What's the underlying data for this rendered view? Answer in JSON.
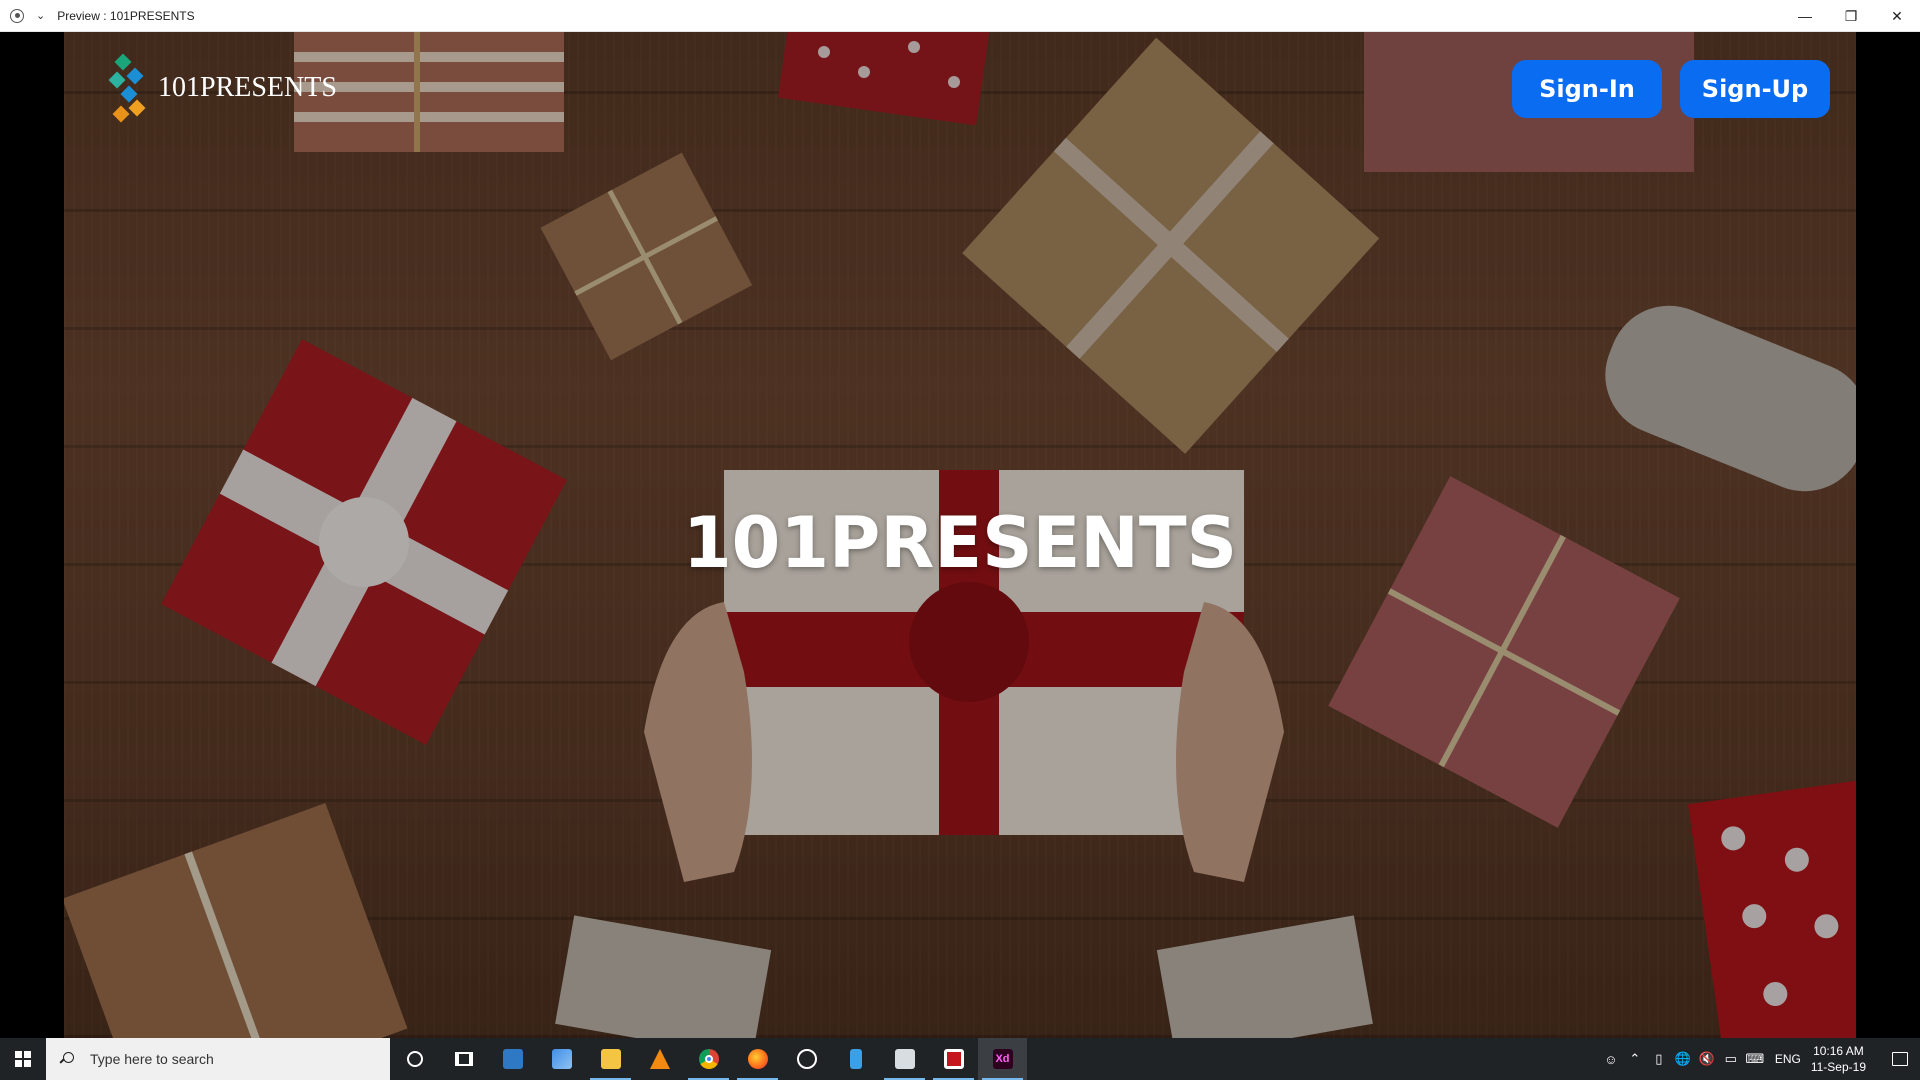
{
  "window": {
    "title": "Preview : 101PRESENTS",
    "controls": [
      "minimize-icon",
      "restore-icon",
      "close-icon"
    ]
  },
  "header": {
    "logo_text": "101PRESENTS",
    "signin_label": "Sign-In",
    "signup_label": "Sign-Up"
  },
  "hero": {
    "title": "101PRESENTS"
  },
  "taskbar": {
    "search_placeholder": "Type here to search",
    "apps": [
      "cortana-icon",
      "task-view-icon",
      "outlook-icon",
      "weather-icon",
      "file-explorer-icon",
      "vlc-icon",
      "chrome-icon",
      "firefox-icon",
      "photos-icon",
      "notepad-icon",
      "remote-desktop-icon",
      "app-icon",
      "adobe-xd-icon"
    ],
    "language": "ENG",
    "time": "10:16 AM",
    "date": "11-Sep-19"
  },
  "colors": {
    "accent_button": "#0a6cf0",
    "taskbar": "#202326",
    "wood": "#5a3a26"
  }
}
